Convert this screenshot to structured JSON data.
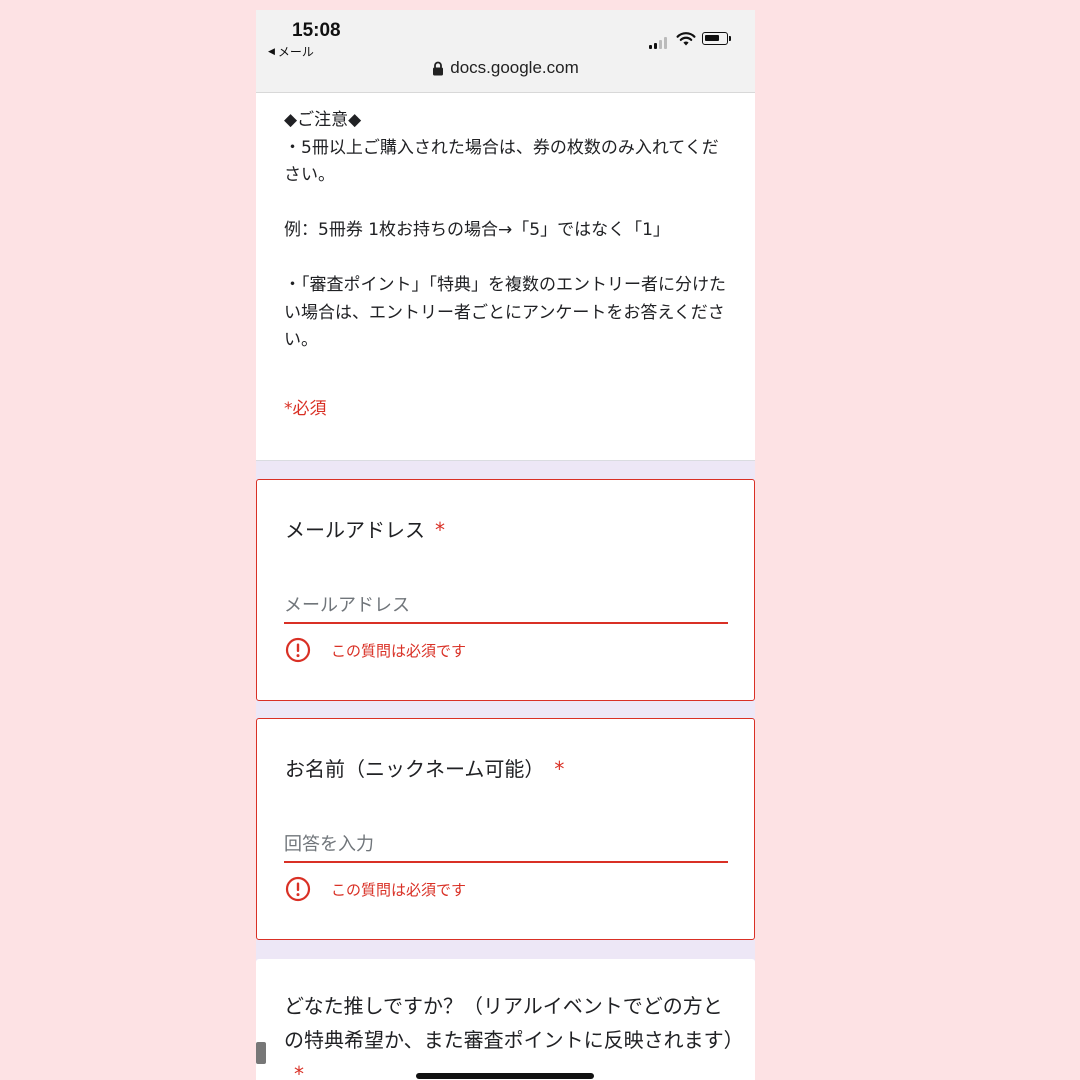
{
  "status_bar": {
    "time": "15:08",
    "back_label": "メール",
    "url": "docs.google.com"
  },
  "notice": {
    "text": "◆ご注意◆\n・5冊以上ご購入された場合は、券の枚数のみ入れてください。\n\n例：5冊券 1枚お持ちの場合→「5」ではなく「1」\n\n・「審査ポイント」「特典」を複数のエントリー者に分けたい場合は、エントリー者ごとにアンケートをお答えください。",
    "required_note": "*必須"
  },
  "questions": {
    "email": {
      "title": "メールアドレス",
      "required_mark": "*",
      "placeholder": "メールアドレス",
      "error": "この質問は必須です"
    },
    "name": {
      "title": "お名前（ニックネーム可能）",
      "required_mark": "*",
      "placeholder": "回答を入力",
      "error": "この質問は必須です"
    },
    "favorite": {
      "title": "どなた推しですか？（リアルイベントでどの方との特典希望か、また審査ポイントに反映されます）",
      "required_mark": "*"
    }
  },
  "colors": {
    "page_background": "#fde2e4",
    "form_background": "#ede7f6",
    "error_red": "#d93025"
  },
  "icons": [
    "back-arrow-icon",
    "signal-icon",
    "wifi-icon",
    "battery-icon",
    "lock-icon",
    "error-icon"
  ]
}
